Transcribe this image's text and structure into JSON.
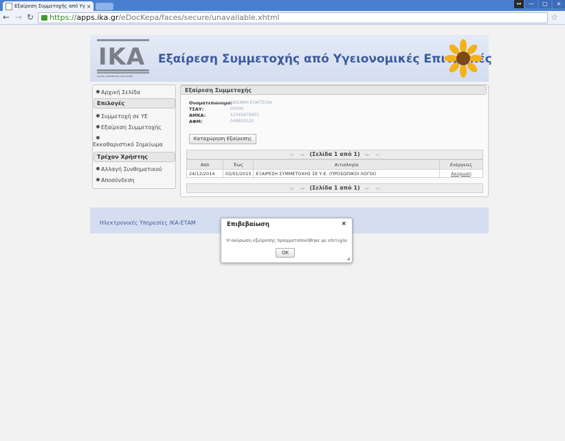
{
  "browser": {
    "tab_title": "Εξαίρεση Συμμετοχής από Υγ",
    "tab_close": "×",
    "url_scheme": "https://",
    "url_host": "apps.ika.gr",
    "url_path": "/eDocKepa/faces/secure/unavailable.xhtml"
  },
  "banner": {
    "logo_text": "IKA",
    "logo_subtitle": "ΙΔΡΥΜΑ ΚΟΙΝΩΝΙΚΩΝ ΑΣΦΑΛΙΣΕΩΝ",
    "title": "Εξαίρεση Συμμετοχής από Υγειονομικές Επιτροπές"
  },
  "sidebar": {
    "home": "Αρχική Σελίδα",
    "options_header": "Επιλογές",
    "item1": "Συμμετοχή σε ΥΕ",
    "item2": "Εξαίρεση Συμμετοχής",
    "item3": "Εκκαθαριστικό Σημείωμα",
    "user_header": "Τρέχον Χρήστης",
    "item4": "Αλλαγή Συνθηματικού",
    "item5": "Αποσύνδεση"
  },
  "panel": {
    "header": "Εξαίρεση Συμμετοχής",
    "fields": [
      {
        "label": "Ονοματεπώνυμο:",
        "value": "ΚΑΙΣΑΝΗ ΕΥΑΓΓΕΛΙΑ"
      },
      {
        "label": "ΤΣΑΥ:",
        "value": "00000"
      },
      {
        "label": "ΑΜΚΑ:",
        "value": "12345678901"
      },
      {
        "label": "ΑΦΜ:",
        "value": "049830120"
      }
    ],
    "register_button": "Καταχώρηση Εξαίρεσης",
    "pager_text": "(Σελίδα 1 από 1)",
    "columns": [
      "Από",
      "Έως",
      "Αιτιολογία",
      "Ενέργειες"
    ],
    "rows": [
      {
        "from": "24/12/2014",
        "to": "02/01/2015",
        "reason": "ΕΞΑΙΡΕΣΗ ΣΥΜΜΕΤΟΧΗΣ ΣΕ Υ.Ε. (ΠΡΟΣΩΠΙΚΟΙ ΛΟΓΟΙ)",
        "action": "Ακύρωση"
      }
    ]
  },
  "footer": {
    "text": "Ηλεκτρονικές Υπηρεσίες ΙΚΑ-ΕΤΑΜ"
  },
  "dialog": {
    "title": "Επιβεβαίωση",
    "close": "×",
    "message": "Η ακύρωση εξαίρεσης πραγματοποιήθηκε με επιτυχία",
    "ok": "OK"
  },
  "colors": {
    "accent": "#3b5a9f",
    "tabbar": "#4a7fd0"
  }
}
